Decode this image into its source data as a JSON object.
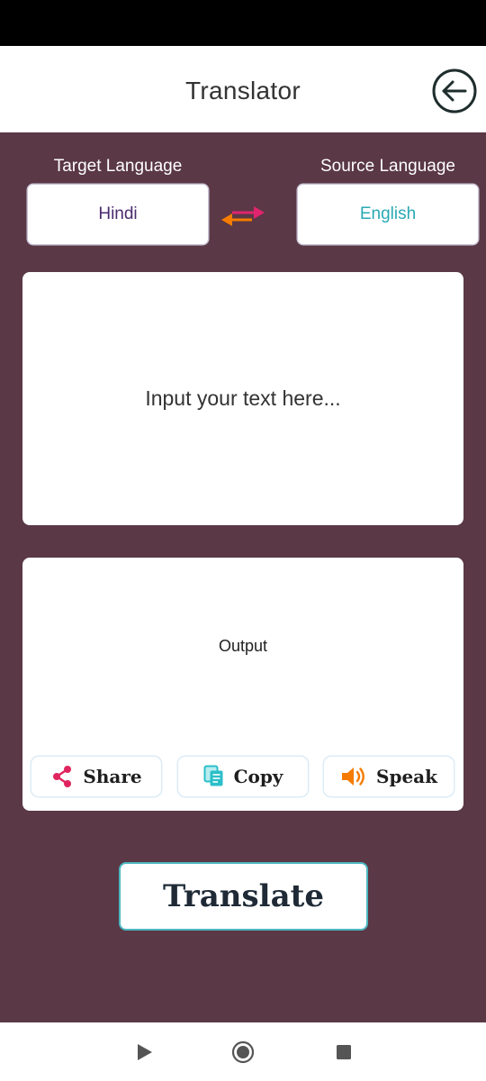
{
  "header": {
    "title": "Translator",
    "back_icon": "arrow-left-circle-icon"
  },
  "languages": {
    "target_label": "Target Language",
    "target_value": "Hindi",
    "source_label": "Source Language",
    "source_value": "English",
    "swap_icon": "swap-arrows-icon"
  },
  "input": {
    "placeholder": "Input your text here...",
    "value": ""
  },
  "output": {
    "text": "Output"
  },
  "actions": {
    "share_label": "Share",
    "share_icon": "share-icon",
    "copy_label": "Copy",
    "copy_icon": "copy-icon",
    "speak_label": "Speak",
    "speak_icon": "speaker-icon"
  },
  "translate_label": "Translate",
  "nav": {
    "back_icon": "nav-back-triangle-icon",
    "home_icon": "nav-home-circle-icon",
    "recents_icon": "nav-recents-square-icon"
  },
  "colors": {
    "background": "#5a3845",
    "target_text": "#4a2a6e",
    "source_text": "#2aa9b4",
    "share_accent": "#e0245e",
    "copy_accent": "#2bbfc9",
    "speak_accent": "#f57c00",
    "translate_border": "#4db8c2"
  }
}
